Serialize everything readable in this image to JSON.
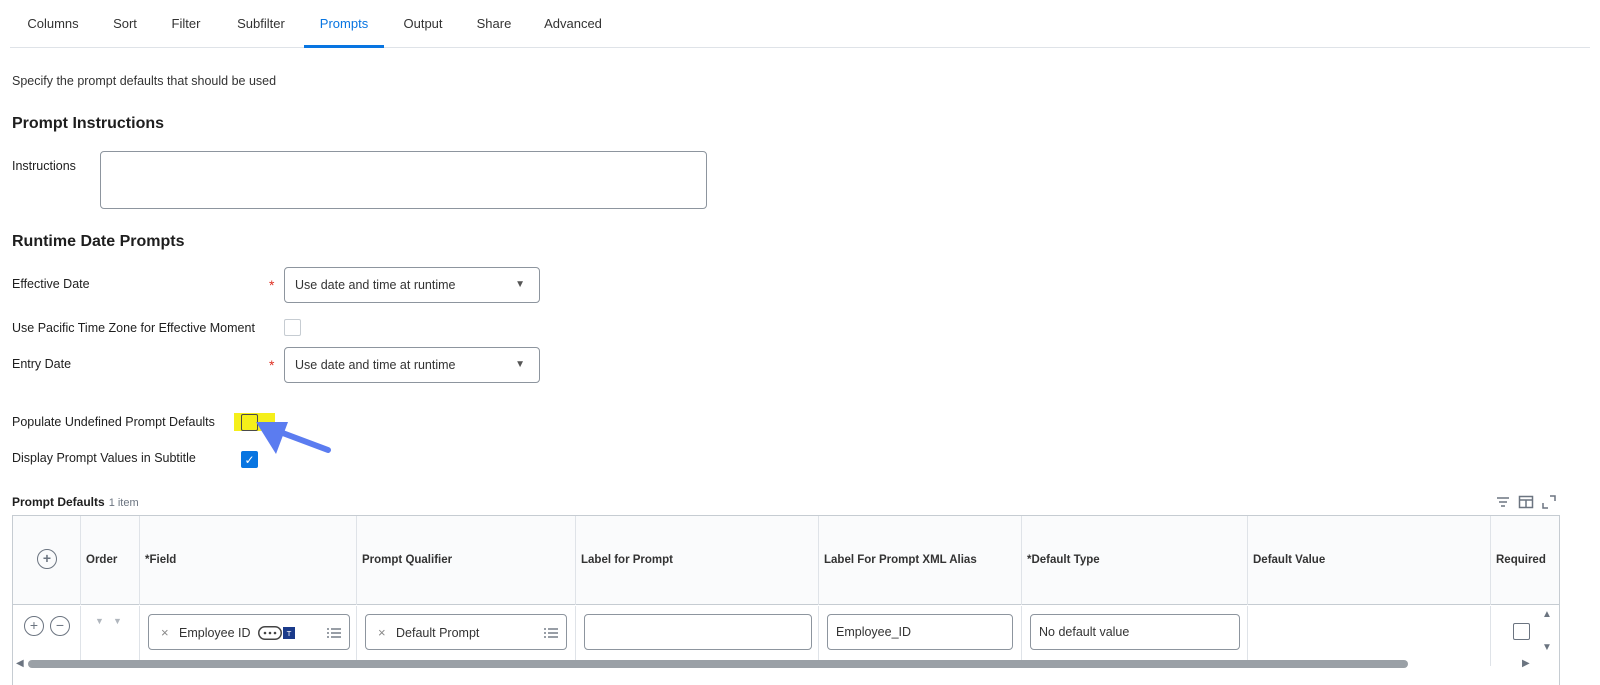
{
  "tabs": [
    {
      "label": "Columns"
    },
    {
      "label": "Sort"
    },
    {
      "label": "Filter"
    },
    {
      "label": "Subfilter"
    },
    {
      "label": "Prompts"
    },
    {
      "label": "Output"
    },
    {
      "label": "Share"
    },
    {
      "label": "Advanced"
    }
  ],
  "active_tab": "Prompts",
  "intro_text": "Specify the prompt defaults that should be used",
  "prompt_instructions": {
    "title": "Prompt Instructions",
    "instructions_label": "Instructions",
    "instructions_value": ""
  },
  "runtime": {
    "title": "Runtime Date Prompts",
    "required_mark": "*",
    "effective_date_label": "Effective Date",
    "effective_date_value": "Use date and time at runtime",
    "pacific_label": "Use Pacific Time Zone for Effective Moment",
    "entry_date_label": "Entry Date",
    "entry_date_value": "Use date and time at runtime"
  },
  "populate_label": "Populate Undefined Prompt Defaults",
  "display_label": "Display Prompt Values in Subtitle",
  "checkmark": "✓",
  "table": {
    "title": "Prompt Defaults",
    "count": "1 item",
    "headers": {
      "order": "Order",
      "field": "*Field",
      "qualifier": "Prompt Qualifier",
      "label": "Label for Prompt",
      "xml_alias": "Label For Prompt XML Alias",
      "default_type": "*Default Type",
      "default_value": "Default Value",
      "required": "Required"
    },
    "row": {
      "field": "Employee ID",
      "qualifier": "Default Prompt",
      "label": "",
      "xml_alias": "Employee_ID",
      "default_type": "No default value",
      "default_value": ""
    }
  },
  "colors": {
    "accent": "#0875e1",
    "highlight": "#f5ef1a",
    "annotation_arrow": "#5b7cf0",
    "required": "#de2e21"
  }
}
